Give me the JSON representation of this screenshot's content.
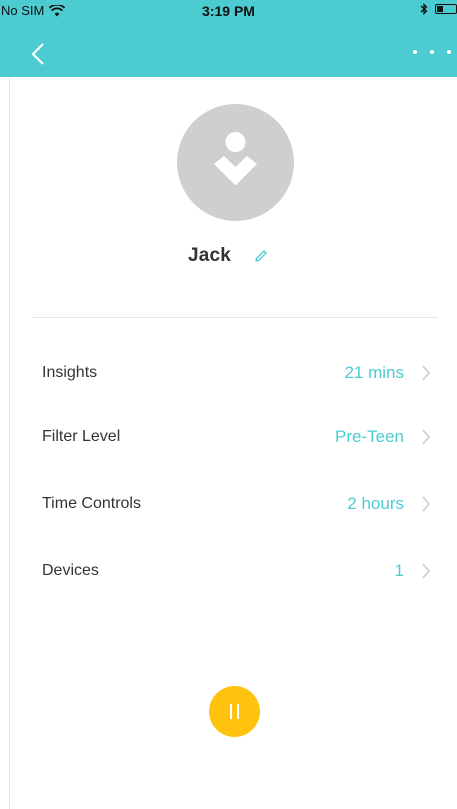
{
  "status_bar": {
    "carrier": "No SIM",
    "time": "3:19 PM"
  },
  "nav": {
    "back_icon": "chevron-left-icon",
    "more_icon": "more-dots-icon"
  },
  "profile": {
    "name": "Jack",
    "avatar_icon": "person-avatar-icon",
    "edit_icon": "pencil-icon"
  },
  "menu": [
    {
      "label": "Insights",
      "value": "21 mins"
    },
    {
      "label": "Filter Level",
      "value": "Pre-Teen"
    },
    {
      "label": "Time Controls",
      "value": "2 hours"
    },
    {
      "label": "Devices",
      "value": "1"
    }
  ],
  "pause_button": {
    "icon": "pause-icon"
  },
  "colors": {
    "accent": "#4ccbd1",
    "pause": "#ffc20e",
    "avatar_bg": "#cfcfcf"
  }
}
